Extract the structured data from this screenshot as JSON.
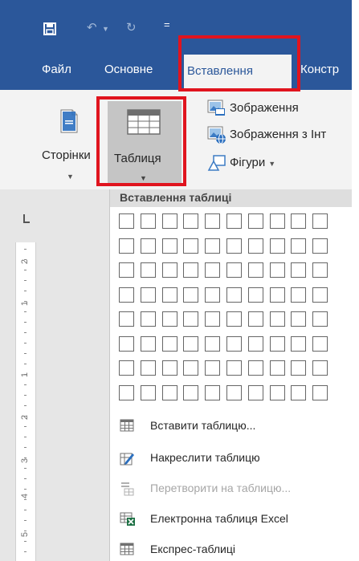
{
  "quick_access": {
    "save_icon": "save-icon",
    "undo_icon": "undo-icon",
    "redo_icon": "redo-icon",
    "customize_glyph": "="
  },
  "tabs": [
    {
      "label": "Файл"
    },
    {
      "label": "Основне"
    },
    {
      "label": "Вставлення",
      "active": true
    },
    {
      "label": "Констр"
    }
  ],
  "ribbon": {
    "pages_label": "Сторінки",
    "table_label": "Таблиця",
    "picture_label": "Зображення",
    "online_picture_label": "Зображення з Інт",
    "shapes_label": "Фігури"
  },
  "ruler": {
    "numbers": [
      "2",
      "1",
      "1",
      "2",
      "3",
      "4",
      "5"
    ]
  },
  "dropdown": {
    "header": "Вставлення таблиці",
    "grid": {
      "columns": 10,
      "rows": 8
    },
    "items": [
      {
        "label": "Вставити таблицю...",
        "enabled": true
      },
      {
        "label": "Накреслити таблицю",
        "enabled": true
      },
      {
        "label": "Перетворити на таблицю...",
        "enabled": false
      },
      {
        "label": "Електронна таблиця Excel",
        "enabled": true
      },
      {
        "label": "Експрес-таблиці",
        "enabled": true
      }
    ]
  },
  "colors": {
    "ribbon_blue": "#2b579a",
    "highlight_red": "#e0141e",
    "ribbon_bg": "#f3f3f3"
  }
}
